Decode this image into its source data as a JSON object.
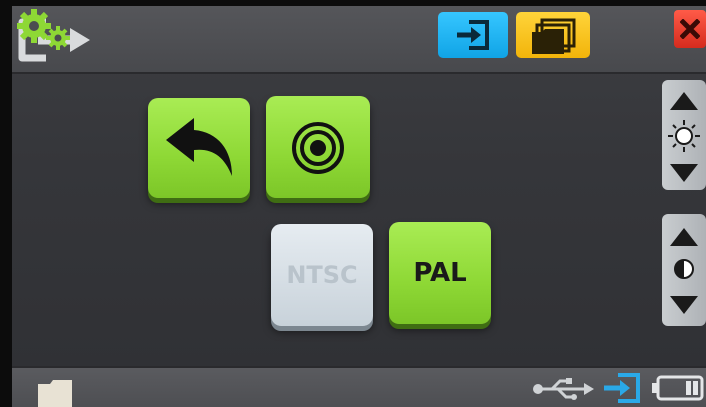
{
  "buttons": {
    "ntsc_label": "NTSC",
    "pal_label": "PAL"
  },
  "icons": {
    "topbar": [
      "exit-icon",
      "input-source-icon",
      "folder-icon",
      "gears-icon",
      "close-icon"
    ],
    "sliders": [
      "brightness-icon",
      "contrast-icon"
    ],
    "status": [
      "folder-icon",
      "usb-icon",
      "input-source-icon",
      "battery-icon"
    ]
  },
  "colors": {
    "accent_green": "#8ed835",
    "tab_blue": "#10a4e6",
    "tab_yellow": "#f2b40a",
    "close_red": "#d52b1e",
    "disabled_gray": "#c8d2da",
    "panel_dark": "#35363a"
  },
  "state": {
    "selected_standard": "PAL",
    "disabled_standard": "NTSC"
  }
}
